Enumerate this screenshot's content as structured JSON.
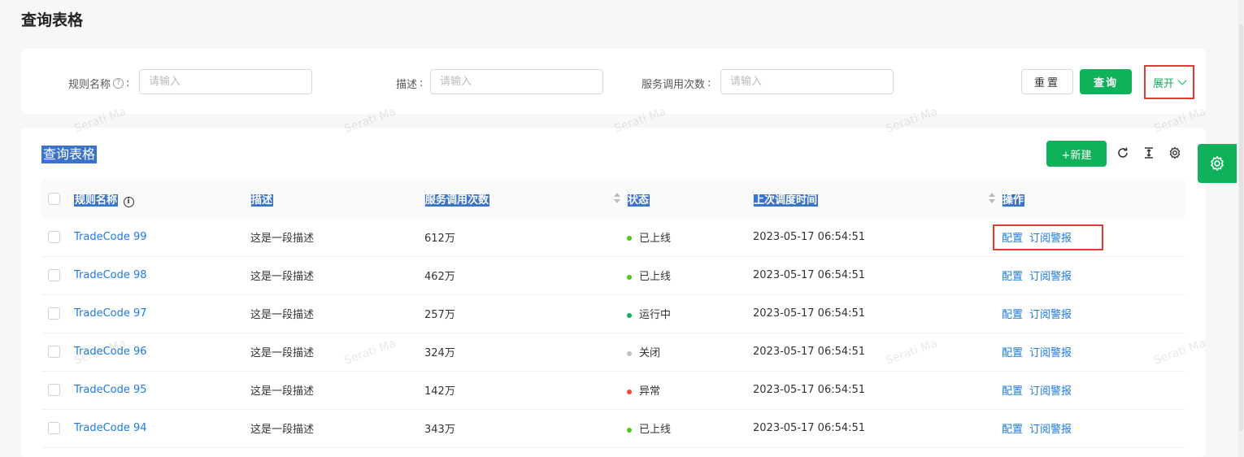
{
  "page_title": "查询表格",
  "search": {
    "fields": [
      {
        "label": "规则名称",
        "has_help": true,
        "placeholder": "请输入"
      },
      {
        "label": "描述",
        "has_help": false,
        "placeholder": "请输入"
      },
      {
        "label": "服务调用次数",
        "has_help": false,
        "placeholder": "请输入"
      }
    ],
    "reset_label": "重置",
    "query_label": "查询",
    "expand_label": "展开"
  },
  "table": {
    "title": "查询表格",
    "new_label": "+新建",
    "columns": [
      "规则名称",
      "描述",
      "服务调用次数",
      "状态",
      "上次调度时间",
      "操作"
    ],
    "rows": [
      {
        "name": "TradeCode 99",
        "desc": "这是一段描述",
        "calls": "612万",
        "status": "已上线",
        "status_color": "#52c41a",
        "time": "2023-05-17 06:54:51",
        "op1": "配置",
        "op2": "订阅警报"
      },
      {
        "name": "TradeCode 98",
        "desc": "这是一段描述",
        "calls": "462万",
        "status": "已上线",
        "status_color": "#52c41a",
        "time": "2023-05-17 06:54:51",
        "op1": "配置",
        "op2": "订阅警报"
      },
      {
        "name": "TradeCode 97",
        "desc": "这是一段描述",
        "calls": "257万",
        "status": "运行中",
        "status_color": "#0fb15a",
        "time": "2023-05-17 06:54:51",
        "op1": "配置",
        "op2": "订阅警报"
      },
      {
        "name": "TradeCode 96",
        "desc": "这是一段描述",
        "calls": "324万",
        "status": "关闭",
        "status_color": "#bfbfbf",
        "time": "2023-05-17 06:54:51",
        "op1": "配置",
        "op2": "订阅警报"
      },
      {
        "name": "TradeCode 95",
        "desc": "这是一段描述",
        "calls": "142万",
        "status": "异常",
        "status_color": "#f5483b",
        "time": "2023-05-17 06:54:51",
        "op1": "配置",
        "op2": "订阅警报"
      },
      {
        "name": "TradeCode 94",
        "desc": "这是一段描述",
        "calls": "343万",
        "status": "已上线",
        "status_color": "#52c41a",
        "time": "2023-05-17 06:54:51",
        "op1": "配置",
        "op2": "订阅警报"
      }
    ]
  },
  "watermark": "Serati Ma",
  "icons": {
    "refresh": "refresh-icon",
    "density": "density-icon",
    "settings": "settings-icon",
    "side": "settings-icon"
  },
  "colors": {
    "primary": "#0fb15a",
    "link": "#1e7be0",
    "highlight": "#e53935"
  }
}
